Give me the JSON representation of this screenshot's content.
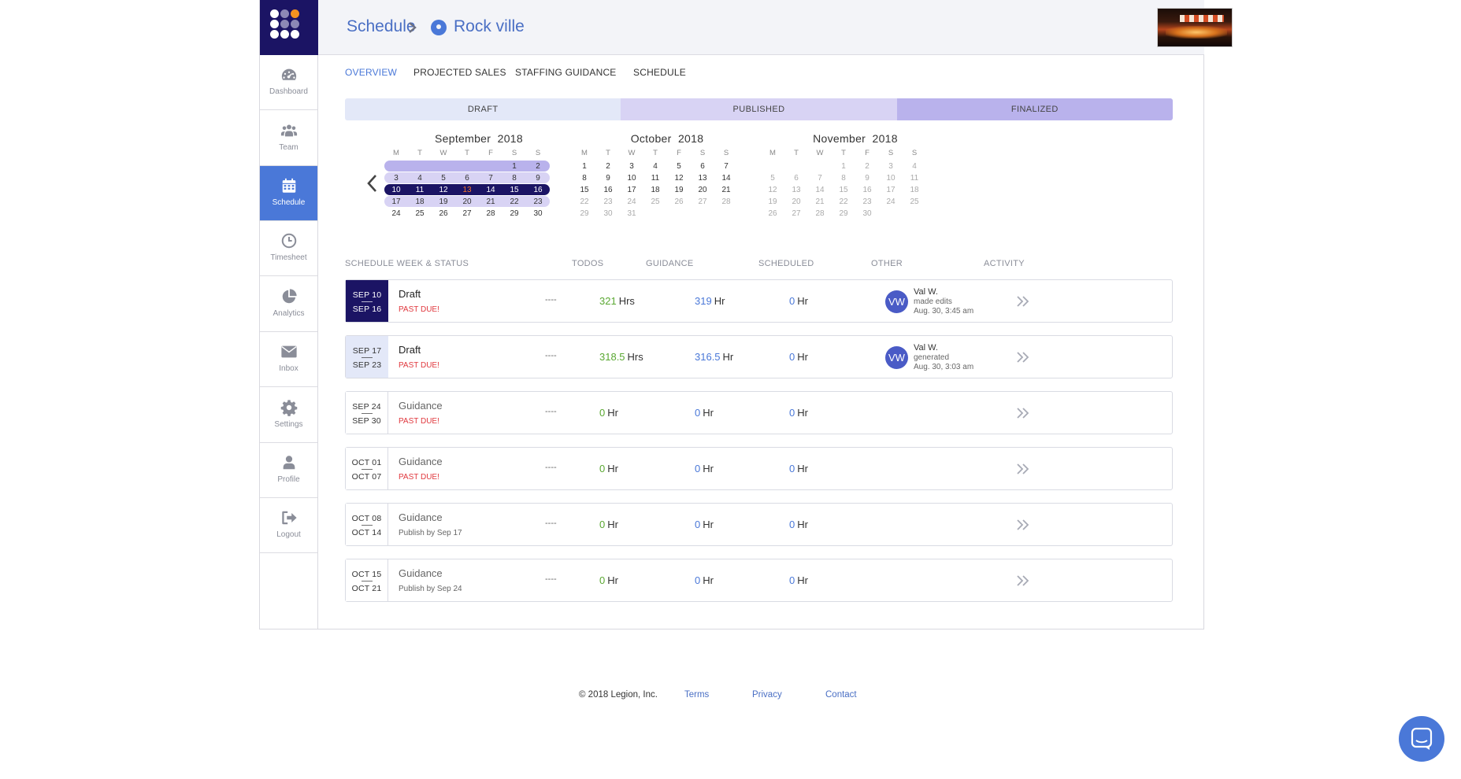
{
  "nav": {
    "items": [
      {
        "label": "Dashboard",
        "icon": "dashboard-icon"
      },
      {
        "label": "Team",
        "icon": "team-icon"
      },
      {
        "label": "Schedule",
        "icon": "calendar-icon",
        "active": true
      },
      {
        "label": "Timesheet",
        "icon": "clock-icon"
      },
      {
        "label": "Analytics",
        "icon": "pie-chart-icon"
      },
      {
        "label": "Inbox",
        "icon": "envelope-icon"
      },
      {
        "label": "Settings",
        "icon": "gear-icon"
      },
      {
        "label": "Profile",
        "icon": "user-icon"
      },
      {
        "label": "Logout",
        "icon": "logout-icon"
      }
    ]
  },
  "header": {
    "section": "Schedule",
    "location": "Rock ville"
  },
  "tabs": [
    "OVERVIEW",
    "PROJECTED SALES",
    "STAFFING GUIDANCE",
    "SCHEDULE"
  ],
  "status_legend": [
    {
      "label": "DRAFT",
      "color": "#e3e8f8"
    },
    {
      "label": "PUBLISHED",
      "color": "#d8d3f4"
    },
    {
      "label": "FINALIZED",
      "color": "#b9b2ec"
    }
  ],
  "calendar": {
    "dow": [
      "M",
      "T",
      "W",
      "T",
      "F",
      "S",
      "S"
    ],
    "months": [
      {
        "month": "September",
        "year": "2018",
        "weeks": [
          [
            "",
            "",
            "",
            "",
            "",
            "1",
            "2"
          ],
          [
            "3",
            "4",
            "5",
            "6",
            "7",
            "8",
            "9"
          ],
          [
            "10",
            "11",
            "12",
            "13",
            "14",
            "15",
            "16"
          ],
          [
            "17",
            "18",
            "19",
            "20",
            "21",
            "22",
            "23"
          ],
          [
            "24",
            "25",
            "26",
            "27",
            "28",
            "29",
            "30"
          ]
        ]
      },
      {
        "month": "October",
        "year": "2018",
        "weeks": [
          [
            "1",
            "2",
            "3",
            "4",
            "5",
            "6",
            "7"
          ],
          [
            "8",
            "9",
            "10",
            "11",
            "12",
            "13",
            "14"
          ],
          [
            "15",
            "16",
            "17",
            "18",
            "19",
            "20",
            "21"
          ],
          [
            "22",
            "23",
            "24",
            "25",
            "26",
            "27",
            "28"
          ],
          [
            "29",
            "30",
            "31",
            "",
            "",
            "",
            ""
          ]
        ]
      },
      {
        "month": "November",
        "year": "2018",
        "weeks": [
          [
            "",
            "",
            "",
            "1",
            "2",
            "3",
            "4"
          ],
          [
            "5",
            "6",
            "7",
            "8",
            "9",
            "10",
            "11"
          ],
          [
            "12",
            "13",
            "14",
            "15",
            "16",
            "17",
            "18"
          ],
          [
            "19",
            "20",
            "21",
            "22",
            "23",
            "24",
            "25"
          ],
          [
            "26",
            "27",
            "28",
            "29",
            "30",
            "",
            ""
          ]
        ]
      }
    ]
  },
  "table": {
    "headers": [
      "SCHEDULE WEEK & STATUS",
      "TODOS",
      "GUIDANCE",
      "SCHEDULED",
      "OTHER",
      "ACTIVITY"
    ],
    "rows": [
      {
        "start": "SEP 10",
        "end": "SEP 16",
        "status": "Draft",
        "sub": "PAST DUE!",
        "todos": "----",
        "guidance": "321",
        "guidance_unit": "Hrs",
        "scheduled": "319",
        "scheduled_unit": "Hr",
        "other": "0",
        "other_unit": "Hr",
        "activity": {
          "initials": "VW",
          "name": "Val W.",
          "action": "made edits",
          "time": "Aug. 30, 3:45 am"
        }
      },
      {
        "start": "SEP 17",
        "end": "SEP 23",
        "status": "Draft",
        "sub": "PAST DUE!",
        "todos": "----",
        "guidance": "318.5",
        "guidance_unit": "Hrs",
        "scheduled": "316.5",
        "scheduled_unit": "Hr",
        "other": "0",
        "other_unit": "Hr",
        "activity": {
          "initials": "VW",
          "name": "Val W.",
          "action": "generated",
          "time": "Aug. 30, 3:03 am"
        }
      },
      {
        "start": "SEP 24",
        "end": "SEP 30",
        "status": "Guidance",
        "sub": "PAST DUE!",
        "todos": "----",
        "guidance": "0",
        "guidance_unit": "Hr",
        "scheduled": "0",
        "scheduled_unit": "Hr",
        "other": "0",
        "other_unit": "Hr",
        "activity": null
      },
      {
        "start": "OCT 01",
        "end": "OCT 07",
        "status": "Guidance",
        "sub": "PAST DUE!",
        "todos": "----",
        "guidance": "0",
        "guidance_unit": "Hr",
        "scheduled": "0",
        "scheduled_unit": "Hr",
        "other": "0",
        "other_unit": "Hr",
        "activity": null
      },
      {
        "start": "OCT 08",
        "end": "OCT 14",
        "status": "Guidance",
        "sub": "Publish by Sep 17",
        "todos": "----",
        "guidance": "0",
        "guidance_unit": "Hr",
        "scheduled": "0",
        "scheduled_unit": "Hr",
        "other": "0",
        "other_unit": "Hr",
        "activity": null
      },
      {
        "start": "OCT 15",
        "end": "OCT 21",
        "status": "Guidance",
        "sub": "Publish by Sep 24",
        "todos": "----",
        "guidance": "0",
        "guidance_unit": "Hr",
        "scheduled": "0",
        "scheduled_unit": "Hr",
        "other": "0",
        "other_unit": "Hr",
        "activity": null
      }
    ]
  },
  "footer": {
    "copyright": "© 2018 Legion, Inc.",
    "links": [
      "Terms",
      "Privacy",
      "Contact"
    ]
  },
  "colors": {
    "brand_navy": "#1b1464",
    "accent_blue": "#4a78d8",
    "past_due_red": "#e0383e",
    "guidance_green": "#5aa832",
    "today_orange": "#f4772b"
  }
}
